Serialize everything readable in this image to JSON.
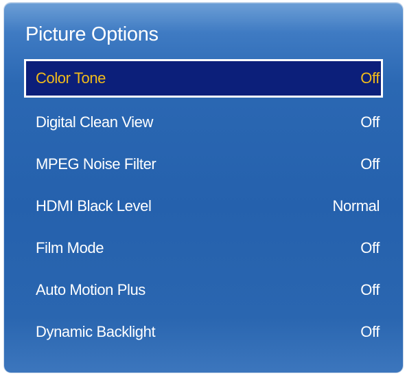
{
  "panel": {
    "title": "Picture Options",
    "items": [
      {
        "label": "Color Tone",
        "value": "Off",
        "selected": true
      },
      {
        "label": "Digital Clean View",
        "value": "Off"
      },
      {
        "label": "MPEG Noise Filter",
        "value": "Off"
      },
      {
        "label": "HDMI Black Level",
        "value": "Normal"
      },
      {
        "label": "Film Mode",
        "value": "Off"
      },
      {
        "label": "Auto Motion Plus",
        "value": "Off"
      },
      {
        "label": "Dynamic Backlight",
        "value": "Off"
      }
    ]
  },
  "colors": {
    "panel_background": "#2561ad",
    "selected_background": "#0c1f7a",
    "selected_text": "#f2bc1a",
    "text": "#ffffff"
  }
}
